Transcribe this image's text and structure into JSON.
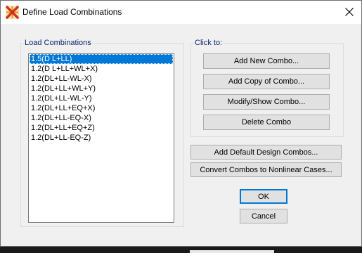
{
  "window": {
    "title": "Define Load Combinations"
  },
  "combinations": {
    "label": "Load Combinations",
    "items": [
      "1.5(D L+LL)",
      "1.2(D L+LL+WL+X)",
      "1.2(DL+LL-WL-X)",
      "1.2(DL+LL+WL+Y)",
      "1.2(DL+LL-WL-Y)",
      "1.2(DL+LL+EQ+X)",
      "1.2(DL+LL-EQ-X)",
      "1.2(DL+LL+EQ+Z)",
      "1.2(DL+LL-EQ-Z)"
    ],
    "selected_index": 0
  },
  "click_to": {
    "label": "Click to:",
    "add_new": "Add New Combo...",
    "add_copy": "Add Copy of Combo...",
    "modify_show": "Modify/Show Combo...",
    "delete": "Delete Combo"
  },
  "actions": {
    "add_default_design": "Add Default Design Combos...",
    "convert_nonlinear": "Convert Combos to Nonlinear Cases...",
    "ok": "OK",
    "cancel": "Cancel"
  },
  "icons": {
    "app": "sap-app-icon",
    "close": "close-icon"
  },
  "colors": {
    "selection": "#0078d7",
    "legend": "#0a246a"
  }
}
